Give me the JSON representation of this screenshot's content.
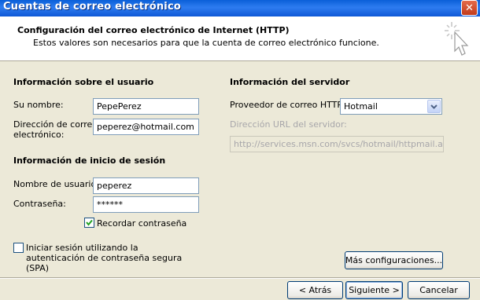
{
  "window": {
    "title": "Cuentas de correo electrónico",
    "close_glyph": "✕"
  },
  "header": {
    "title": "Configuración del correo electrónico de Internet (HTTP)",
    "subtitle": "Estos valores son necesarios para que la cuenta de correo electrónico funcione."
  },
  "user_info": {
    "title": "Información sobre el usuario",
    "name_label": "Su nombre:",
    "name_value": "PepePerez",
    "email_label_1": "Dirección de correo",
    "email_label_2": "electrónico:",
    "email_value": "peperez@hotmail.com"
  },
  "login_info": {
    "title": "Información de inicio de sesión",
    "username_label": "Nombre de usuario:",
    "username_value": "peperez",
    "password_label": "Contraseña:",
    "password_value": "******",
    "remember_label": "Recordar contraseña",
    "remember_checked": true,
    "spa_label_1": "Iniciar sesión utilizando la",
    "spa_label_2": "autenticación de contraseña segura",
    "spa_label_3": "(SPA)",
    "spa_checked": false
  },
  "server_info": {
    "title": "Información del servidor",
    "provider_label": "Proveedor de correo HTTP:",
    "provider_value": "Hotmail",
    "url_label": "Dirección URL del servidor:",
    "url_value": "http://services.msn.com/svcs/hotmail/httpmail.asp"
  },
  "buttons": {
    "more_settings": "Más configuraciones...",
    "back": "< Atrás",
    "next": "Siguiente >",
    "cancel": "Cancelar"
  }
}
